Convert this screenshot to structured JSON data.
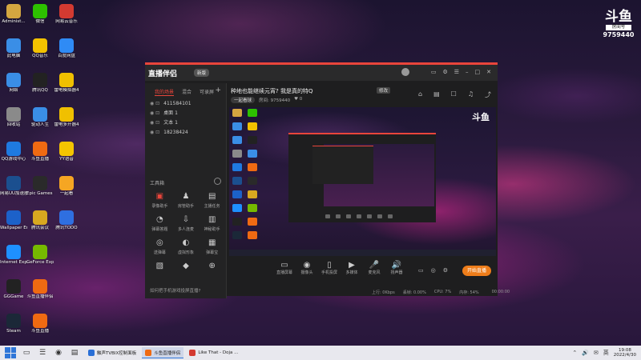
{
  "desktop": {
    "icons": [
      {
        "label": "Administ...",
        "icon": "user-folder-icon",
        "color": "#d4a640",
        "col": 0,
        "row": 0
      },
      {
        "label": "微信",
        "icon": "wechat-icon",
        "color": "#2dc100",
        "col": 1,
        "row": 0
      },
      {
        "label": "网易云音乐",
        "icon": "netease-music-icon",
        "color": "#d33a31",
        "col": 2,
        "row": 0
      },
      {
        "label": "此电脑",
        "icon": "computer-icon",
        "color": "#3a8ee6",
        "col": 0,
        "row": 1
      },
      {
        "label": "QQ音乐",
        "icon": "qq-music-icon",
        "color": "#f2c200",
        "col": 1,
        "row": 1
      },
      {
        "label": "百度网盘",
        "icon": "baidu-netdisk-icon",
        "color": "#2f8bf5",
        "col": 2,
        "row": 1
      },
      {
        "label": "网络",
        "icon": "network-icon",
        "color": "#3a8ee6",
        "col": 0,
        "row": 2
      },
      {
        "label": "腾讯QQ",
        "icon": "qq-icon",
        "color": "#222222",
        "col": 1,
        "row": 2
      },
      {
        "label": "雷电模拟器4",
        "icon": "ldplayer-icon",
        "color": "#f0c000",
        "col": 2,
        "row": 2
      },
      {
        "label": "回收站",
        "icon": "recycle-bin-icon",
        "color": "#8a8a8a",
        "col": 0,
        "row": 3
      },
      {
        "label": "驱动人生",
        "icon": "driver-icon",
        "color": "#3a8ee6",
        "col": 1,
        "row": 3
      },
      {
        "label": "雷电多开器4",
        "icon": "ldmulti-icon",
        "color": "#f0c000",
        "col": 2,
        "row": 3
      },
      {
        "label": "QQ游戏中心",
        "icon": "qq-game-icon",
        "color": "#1f7ae0",
        "col": 0,
        "row": 4
      },
      {
        "label": "斗鱼直播",
        "icon": "douyu-icon",
        "color": "#ef6a12",
        "col": 1,
        "row": 4
      },
      {
        "label": "YY语音",
        "icon": "yy-icon",
        "color": "#f5c400",
        "col": 2,
        "row": 4
      },
      {
        "label": "网易UU加速器",
        "icon": "uu-icon",
        "color": "#1b4f8f",
        "col": 0,
        "row": 5
      },
      {
        "label": "Epic Games Launcher",
        "icon": "epic-icon",
        "color": "#2a2a2a",
        "col": 1,
        "row": 5
      },
      {
        "label": "一起看",
        "icon": "watch-icon",
        "color": "#f5a623",
        "col": 2,
        "row": 5
      },
      {
        "label": "Wallpaper Engine",
        "icon": "wallpaper-icon",
        "color": "#1c61c9",
        "col": 0,
        "row": 6
      },
      {
        "label": "腾讯会议",
        "icon": "meeting-icon",
        "color": "#d8a820",
        "col": 1,
        "row": 6
      },
      {
        "label": "腾讯TODO",
        "icon": "todo-icon",
        "color": "#2f6fe0",
        "col": 2,
        "row": 6
      },
      {
        "label": "Internet Explorer",
        "icon": "ie-icon",
        "color": "#1e90ff",
        "col": 0,
        "row": 7
      },
      {
        "label": "GeForce Experience",
        "icon": "geforce-icon",
        "color": "#76b900",
        "col": 1,
        "row": 7
      },
      {
        "label": "GGGame",
        "icon": "gg-icon",
        "color": "#222222",
        "col": 0,
        "row": 8
      },
      {
        "label": "斗鱼直播伴侣",
        "icon": "douyu-companion-icon",
        "color": "#ef6a12",
        "col": 1,
        "row": 8
      },
      {
        "label": "Steam",
        "icon": "steam-icon",
        "color": "#1b2838",
        "col": 0,
        "row": 9
      },
      {
        "label": "斗鱼直播",
        "icon": "douyu-live-icon",
        "color": "#ef6a12",
        "col": 1,
        "row": 9
      }
    ],
    "room_badge": {
      "logo": "斗鱼",
      "sub": "房间号",
      "number": "9759440"
    }
  },
  "app": {
    "name": "直播伴侣",
    "version": "新版",
    "window_controls": [
      "▭",
      "⚙",
      "☰",
      "–",
      "□",
      "✕"
    ],
    "side_tabs": [
      "我的场景",
      "混合",
      "可录屏"
    ],
    "scenes": [
      "411584101",
      "桌面 1",
      "文本 1",
      "18238424"
    ],
    "tools_title": "工具箱",
    "tools": [
      {
        "label": "录像助手",
        "glyph": "▣",
        "active": true
      },
      {
        "label": "房管助手",
        "glyph": "♟",
        "active": false
      },
      {
        "label": "主播任务",
        "glyph": "▤",
        "active": false
      },
      {
        "label": "弹幕答题",
        "glyph": "◔",
        "active": false
      },
      {
        "label": "多人连麦",
        "glyph": "⇩",
        "active": false
      },
      {
        "label": "神秘助手",
        "glyph": "▥",
        "active": false
      },
      {
        "label": "送弹幕",
        "glyph": "◎",
        "active": false
      },
      {
        "label": "虚拟形象",
        "glyph": "◐",
        "active": false
      },
      {
        "label": "弹幕宝",
        "glyph": "▦",
        "active": false
      },
      {
        "label": "",
        "glyph": "▧",
        "active": false
      },
      {
        "label": "",
        "glyph": "◆",
        "active": false
      },
      {
        "label": "",
        "glyph": "⊕",
        "active": false
      }
    ],
    "help_text": "如何把手机游戏投屏直播?",
    "topic": "种地也能继续元宵? 我是真的特Q",
    "topic_edit": "修改",
    "category": "一起看球",
    "room_no": "房间: 9759440",
    "fans": "♥ 0",
    "main_icons": [
      "⌂",
      "▤",
      "☐",
      "♫",
      "⤴"
    ],
    "controls": [
      {
        "label": "直播屏幕",
        "glyph": "▭"
      },
      {
        "label": "摄像头",
        "glyph": "◉"
      },
      {
        "label": "手机投屏",
        "glyph": "▯"
      },
      {
        "label": "多媒体",
        "glyph": "▶"
      },
      {
        "label": "麦克风",
        "glyph": "🎤"
      },
      {
        "label": "扬声器",
        "glyph": "🔊"
      }
    ],
    "mini_icons": [
      "▭",
      "◎",
      "⚙"
    ],
    "live_button": "开始直播",
    "status": [
      "上行: 0Kbps",
      "丢帧: 0.00%",
      "CPU: 7%",
      "内存: 54%",
      "00:00:00"
    ],
    "preview_badge": "斗鱼"
  },
  "taskbar": {
    "apps": [
      {
        "label": "触声TVBIX控制面板",
        "color": "#2a6fd6",
        "active": false
      },
      {
        "label": "斗鱼直播伴侣",
        "color": "#ef6a12",
        "active": true
      },
      {
        "label": "Like That - Doja ...",
        "color": "#d33a31",
        "active": false
      }
    ],
    "pinned": [
      "▭",
      "☰",
      "◉",
      "▤"
    ],
    "tray": [
      "⌃",
      "🔊",
      "✉"
    ],
    "tray_lang": "英",
    "time": "19:08",
    "date": "2022/4/30"
  }
}
